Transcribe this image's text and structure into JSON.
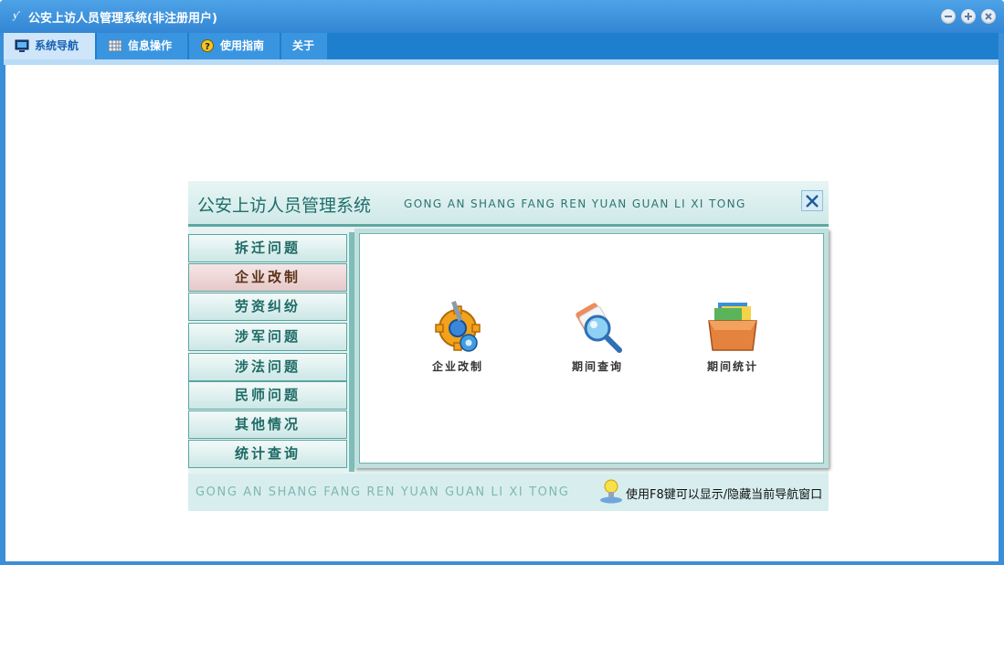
{
  "window": {
    "title": "公安上访人员管理系统(非注册用户)",
    "app_icon_glyph": "ƴ",
    "colors": {
      "titlebar": "#3a8fd8",
      "tabbar": "#1e7fcf",
      "active_tab": "#cfe6fa"
    }
  },
  "tabs": [
    {
      "label": "系统导航",
      "icon": "monitor-icon",
      "active": true
    },
    {
      "label": "信息操作",
      "icon": "grid-icon",
      "active": false
    },
    {
      "label": "使用指南",
      "icon": "help-icon",
      "active": false
    },
    {
      "label": "关于",
      "icon": "",
      "active": false
    }
  ],
  "nav": {
    "title": "公安上访人员管理系统",
    "pinyin": "GONG AN SHANG FANG REN YUAN GUAN LI XI TONG",
    "menu": [
      "拆迁问题",
      "企业改制",
      "劳资纠纷",
      "涉军问题",
      "涉法问题",
      "民师问题",
      "其他情况",
      "统计查询"
    ],
    "active_menu": "企业改制",
    "functions": [
      {
        "label": "企业改制",
        "icon": "gear-icon"
      },
      {
        "label": "期间查询",
        "icon": "magnifier-icon"
      },
      {
        "label": "期间统计",
        "icon": "folder-box-icon"
      }
    ],
    "footer": {
      "pinyin": "GONG AN SHANG FANG REN YUAN GUAN LI XI TONG",
      "hint": "使用F8键可以显示/隐藏当前导航窗口"
    }
  }
}
